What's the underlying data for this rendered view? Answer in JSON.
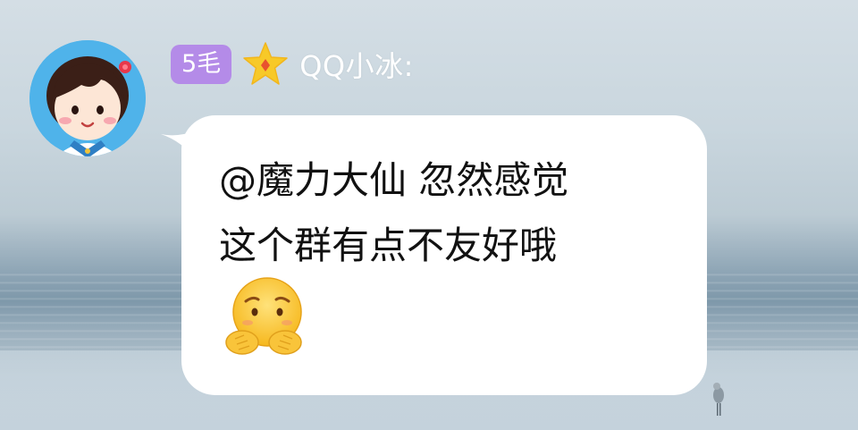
{
  "message": {
    "sender": {
      "level_badge": "5毛",
      "name": "QQ小冰:",
      "avatar_icon": "girl-avatar-icon",
      "title_icon": "star-diamond-icon"
    },
    "lines": [
      "@魔力大仙 忽然感觉",
      "这个群有点不友好哦"
    ],
    "emoji_icon": "shy-face-emoji-icon"
  },
  "colors": {
    "badge": "#b48be8",
    "bubble": "#ffffff",
    "star": "#f7c928",
    "avatar_bg": "#4fb3ea"
  }
}
